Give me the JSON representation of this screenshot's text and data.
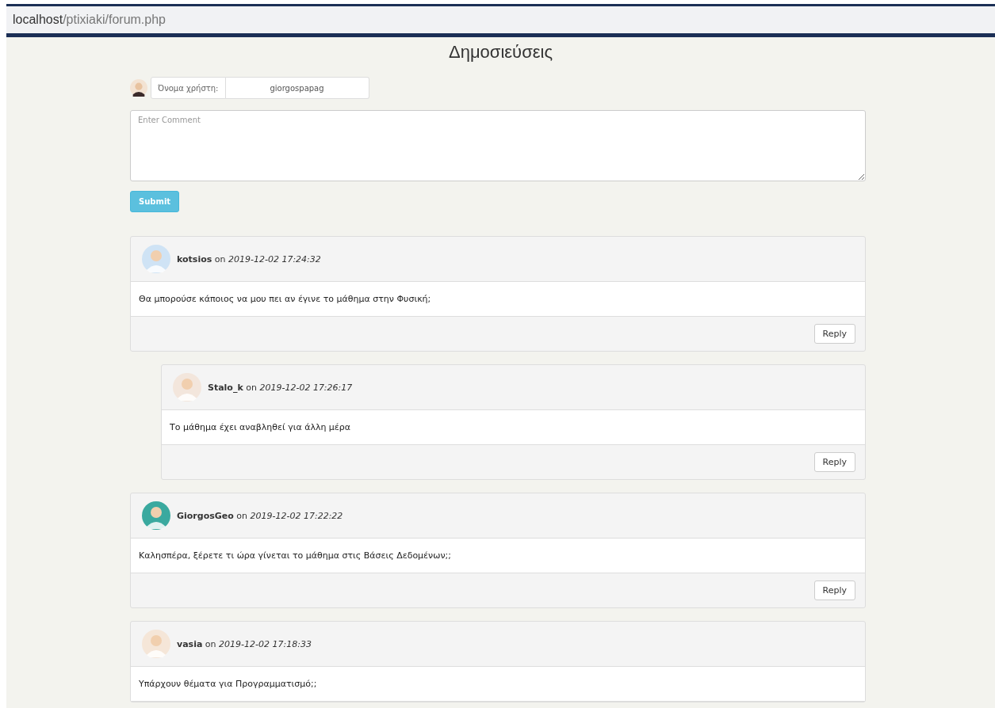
{
  "address_bar": {
    "host": "localhost",
    "path": "/ptixiaki/forum.php"
  },
  "page_title": "Δημοσιεύσεις",
  "user_field": {
    "label": "Όνομα χρήστη:",
    "value": "giorgospapag"
  },
  "comment_field": {
    "placeholder": "Enter Comment"
  },
  "submit_button": "Submit",
  "comments": [
    {
      "author": "kotsios",
      "on": "on",
      "date": "2019-12-02 17:24:32",
      "text": "Θα μπορούσε κάποιος να μου πει αν έγινε το μάθημα στην Φυσική;",
      "reply": "Reply",
      "children": [
        {
          "author": "Stalo_k",
          "on": "on",
          "date": "2019-12-02 17:26:17",
          "text": "Το μάθημα έχει αναβληθεί για άλλη μέρα",
          "reply": "Reply"
        }
      ]
    },
    {
      "author": "GiorgosGeo",
      "on": "on",
      "date": "2019-12-02 17:22:22",
      "text": "Καλησπέρα, ξέρετε τι ώρα γίνεται το μάθημα στις Βάσεις Δεδομένων;;",
      "reply": "Reply"
    },
    {
      "author": "vasia",
      "on": "on",
      "date": "2019-12-02 17:18:33",
      "text": "Υπάρχουν θέματα για Προγραμματισμό;;"
    }
  ]
}
